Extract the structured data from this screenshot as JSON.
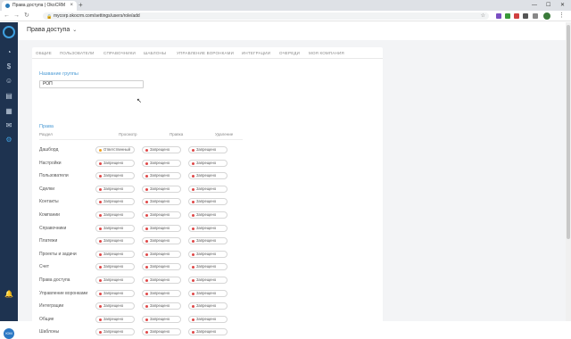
{
  "browser": {
    "tab_title": "Права доступа | OkoCRM",
    "url": "mycorp.okocrm.com/settings/users/role/add",
    "new_tab": "+",
    "close_tab": "×"
  },
  "sidebar": {
    "user_initials": "ЮМ"
  },
  "header": {
    "title": "Права доступа"
  },
  "settings_tabs": [
    "ОБЩИЕ",
    "ПОЛЬЗОВАТЕЛИ",
    "СПРАВОЧНИКИ",
    "ШАБЛОНЫ",
    "УПРАВЛЕНИЕ ВОРОНКАМИ",
    "ИНТЕГРАЦИИ",
    "ОЧЕРЕДИ",
    "МОЯ КОМПАНИЯ"
  ],
  "form": {
    "group_label": "Название группы",
    "group_value": "РОП",
    "rights_label": "Права",
    "columns": [
      "Раздел",
      "Просмотр",
      "Правка",
      "Удаление"
    ]
  },
  "colors": {
    "denied": "#e04848",
    "responsible": "#f0a020"
  },
  "rows": [
    {
      "name": "Дашборд",
      "view": "Ответственный",
      "view_status": "responsible",
      "edit": "Запрещено",
      "delete": "Запрещено"
    },
    {
      "name": "Настройки",
      "view": "Запрещено",
      "view_status": "denied",
      "edit": "Запрещено",
      "delete": "Запрещено"
    },
    {
      "name": "Пользователи",
      "view": "Запрещено",
      "view_status": "denied",
      "edit": "Запрещено",
      "delete": "Запрещено"
    },
    {
      "name": "Сделки",
      "view": "Запрещено",
      "view_status": "denied",
      "edit": "Запрещено",
      "delete": "Запрещено"
    },
    {
      "name": "Контакты",
      "view": "Запрещено",
      "view_status": "denied",
      "edit": "Запрещено",
      "delete": "Запрещено"
    },
    {
      "name": "Компании",
      "view": "Запрещено",
      "view_status": "denied",
      "edit": "Запрещено",
      "delete": "Запрещено"
    },
    {
      "name": "Справочники",
      "view": "Запрещено",
      "view_status": "denied",
      "edit": "Запрещено",
      "delete": "Запрещено"
    },
    {
      "name": "Платежи",
      "view": "Запрещено",
      "view_status": "denied",
      "edit": "Запрещено",
      "delete": "Запрещено"
    },
    {
      "name": "Проекты и задачи",
      "view": "Запрещено",
      "view_status": "denied",
      "edit": "Запрещено",
      "delete": "Запрещено"
    },
    {
      "name": "Счет",
      "view": "Запрещено",
      "view_status": "denied",
      "edit": "Запрещено",
      "delete": "Запрещено"
    },
    {
      "name": "Права доступа",
      "view": "Запрещено",
      "view_status": "denied",
      "edit": "Запрещено",
      "delete": "Запрещено"
    },
    {
      "name": "Управление воронками",
      "view": "Запрещено",
      "view_status": "denied",
      "edit": "Запрещено",
      "delete": "Запрещено"
    },
    {
      "name": "Интеграции",
      "view": "Запрещено",
      "view_status": "denied",
      "edit": "Запрещено",
      "delete": "Запрещено"
    },
    {
      "name": "Общие",
      "view": "Запрещено",
      "view_status": "denied",
      "edit": "Запрещено",
      "delete": "Запрещено"
    },
    {
      "name": "Шаблоны",
      "view": "Запрещено",
      "view_status": "denied",
      "edit": "Запрещено",
      "delete": "Запрещено"
    }
  ]
}
